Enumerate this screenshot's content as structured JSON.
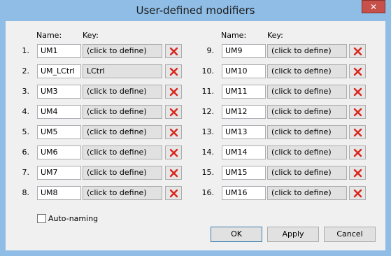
{
  "window": {
    "title": "User-defined modifiers",
    "close_glyph": "✕"
  },
  "headers": {
    "name": "Name:",
    "key": "Key:"
  },
  "modifiers": [
    {
      "num": "1.",
      "name": "UM1",
      "key": "(click to define)"
    },
    {
      "num": "2.",
      "name": "UM_LCtrl",
      "key": "LCtrl"
    },
    {
      "num": "3.",
      "name": "UM3",
      "key": "(click to define)"
    },
    {
      "num": "4.",
      "name": "UM4",
      "key": "(click to define)"
    },
    {
      "num": "5.",
      "name": "UM5",
      "key": "(click to define)"
    },
    {
      "num": "6.",
      "name": "UM6",
      "key": "(click to define)"
    },
    {
      "num": "7.",
      "name": "UM7",
      "key": "(click to define)"
    },
    {
      "num": "8.",
      "name": "UM8",
      "key": "(click to define)"
    },
    {
      "num": "9.",
      "name": "UM9",
      "key": "(click to define)"
    },
    {
      "num": "10.",
      "name": "UM10",
      "key": "(click to define)"
    },
    {
      "num": "11.",
      "name": "UM11",
      "key": "(click to define)"
    },
    {
      "num": "12.",
      "name": "UM12",
      "key": "(click to define)"
    },
    {
      "num": "13.",
      "name": "UM13",
      "key": "(click to define)"
    },
    {
      "num": "14.",
      "name": "UM14",
      "key": "(click to define)"
    },
    {
      "num": "15.",
      "name": "UM15",
      "key": "(click to define)"
    },
    {
      "num": "16.",
      "name": "UM16",
      "key": "(click to define)"
    }
  ],
  "auto_naming": {
    "label": "Auto-naming",
    "checked": false
  },
  "buttons": {
    "ok": "OK",
    "apply": "Apply",
    "cancel": "Cancel"
  },
  "icons": {
    "delete": "red-x-icon"
  },
  "colors": {
    "delete_icon": "#d9261c",
    "title_bar": "#8fbde6",
    "close_button": "#c7504a"
  }
}
